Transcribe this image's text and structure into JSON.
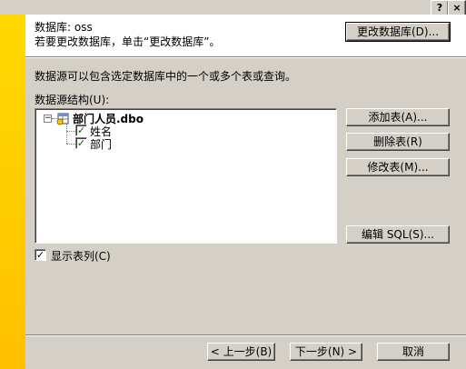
{
  "title_buttons": {
    "help": "?",
    "close": "×"
  },
  "header": {
    "database_line": "数据库: oss",
    "instruction": "若要更改数据库，单击“更改数据库”。",
    "change_db_button": "更改数据库(D)..."
  },
  "body": {
    "description": "数据源可以包含选定数据库中的一个或多个表或查询。",
    "structure_label": "数据源结构(U):"
  },
  "tree": {
    "expander": "−",
    "table_name": "部门人员.dbo",
    "fields": [
      "姓名",
      "部门"
    ]
  },
  "actions": {
    "add_table": "添加表(A)...",
    "delete_table": "删除表(R)",
    "modify_table": "修改表(M)...",
    "edit_sql": "编辑 SQL(S)..."
  },
  "show_columns": {
    "checked": true,
    "label": "显示表列(C)"
  },
  "footer": {
    "back": "< 上一步(B)",
    "next": "下一步(N) >",
    "cancel": "取消"
  },
  "colors": {
    "banner": "#ffcc00",
    "face": "#d4d0c8",
    "check": "#006400"
  }
}
